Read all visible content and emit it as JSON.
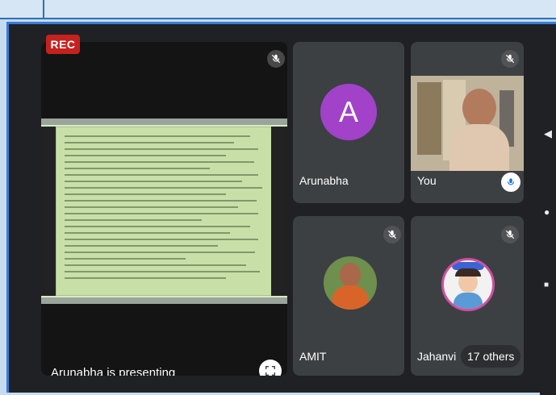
{
  "meeting": {
    "rec_label": "REC",
    "presenter_label": "Arunabha is presenting",
    "participants": [
      {
        "name": "Arunabha",
        "avatar_letter": "A"
      },
      {
        "name": "You"
      },
      {
        "name": "AMIT"
      },
      {
        "name": "Jahanvi"
      }
    ],
    "others_count": "17 others"
  },
  "colors": {
    "rec": "#c5221f",
    "avatar_a": "#a142c9",
    "tile": "#3c4043",
    "background": "#202124",
    "slide": "#c8e0a8"
  },
  "icons": [
    "mic-off-icon",
    "fullscreen-icon",
    "chevron-left-icon",
    "record-dot-icon",
    "stop-icon"
  ]
}
